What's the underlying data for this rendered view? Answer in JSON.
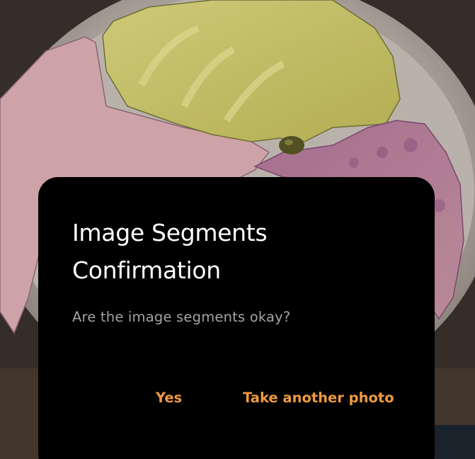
{
  "background": {
    "description_icon": "food-photo-segmented"
  },
  "dialog": {
    "title": "Image Segments Confirmation",
    "message": "Are the image segments okay?",
    "buttons": {
      "yes": "Yes",
      "retake": "Take another photo"
    }
  },
  "colors": {
    "dialog_bg": "#000000",
    "title": "#ffffff",
    "message": "#a3a3a3",
    "accent": "#ed9a3f"
  }
}
